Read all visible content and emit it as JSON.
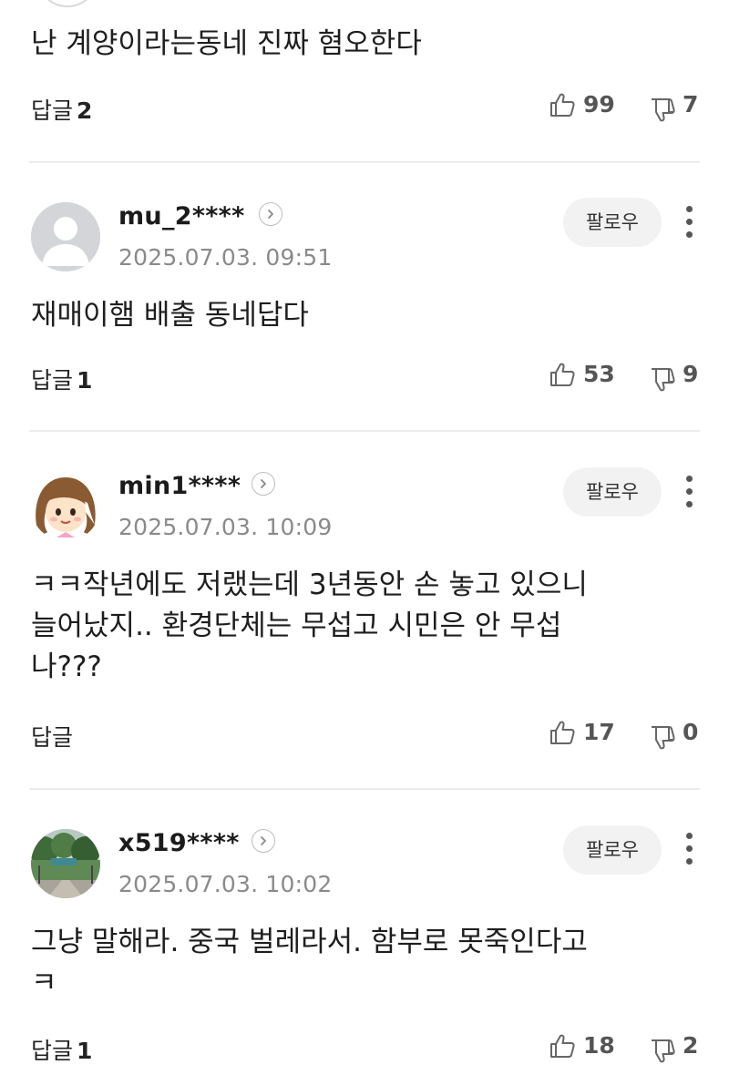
{
  "comments": [
    {
      "text": "난 계양이라는동네 진짜 혐오한다",
      "reply_label": "답글",
      "reply_count": "2",
      "likes": "99",
      "dislikes": "7"
    },
    {
      "username": "mu_2****",
      "date": "2025.07.03. 09:51",
      "follow_label": "팔로우",
      "text": "재매이햄 배출 동네답다",
      "reply_label": "답글",
      "reply_count": "1",
      "likes": "53",
      "dislikes": "9",
      "avatar": "default-user-icon"
    },
    {
      "username": "min1****",
      "date": "2025.07.03. 10:09",
      "follow_label": "팔로우",
      "text_lines": [
        "ㅋㅋ작년에도 저랬는데 3년동안 손 놓고 있으니",
        "늘어났지.. 환경단체는 무섭고 시민은 안 무섭",
        "나???"
      ],
      "reply_label": "답글",
      "reply_count": "",
      "likes": "17",
      "dislikes": "0",
      "avatar": "cartoon-girl-avatar"
    },
    {
      "username": "x519****",
      "date": "2025.07.03. 10:02",
      "follow_label": "팔로우",
      "text_lines": [
        "그냥 말해라. 중국 벌레라서. 함부로 못죽인다고",
        "ㅋ"
      ],
      "reply_label": "답글",
      "reply_count": "1",
      "likes": "18",
      "dislikes": "2",
      "avatar": "landscape-photo-avatar"
    }
  ],
  "icons": {
    "like": "thumbs-up-icon",
    "dislike": "thumbs-down-icon",
    "profile_link": "chevron-right-icon",
    "menu": "more-vertical-icon"
  },
  "colors": {
    "text": "#1e1e1e",
    "muted": "#8a8a8a",
    "follow_bg": "#f2f2f2",
    "divider": "#ececec"
  }
}
